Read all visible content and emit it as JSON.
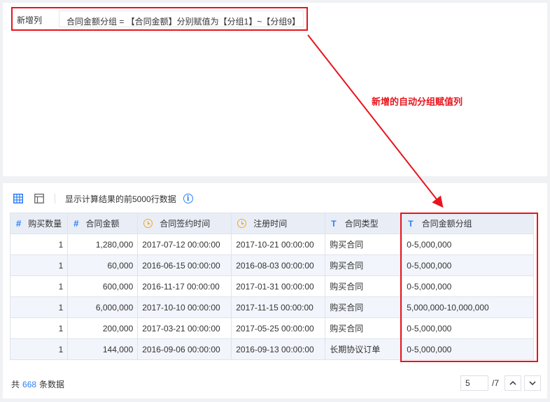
{
  "formula": {
    "label": "新增列",
    "expression": "合同金额分组 = 【合同金额】分别赋值为【分组1】~【分组9】"
  },
  "annotation": {
    "text": "新增的自动分组赋值列",
    "color": "#e8141d"
  },
  "toolbar": {
    "info_text": "显示计算结果的前5000行数据",
    "icons": [
      "grid-view-icon",
      "table-view-icon",
      "info-icon"
    ]
  },
  "table": {
    "headers": [
      {
        "label": "购买数量",
        "icon": "hash"
      },
      {
        "label": "合同金额",
        "icon": "hash"
      },
      {
        "label": "合同签约时间",
        "icon": "clock"
      },
      {
        "label": "注册时间",
        "icon": "clock"
      },
      {
        "label": "合同类型",
        "icon": "text"
      },
      {
        "label": "合同金额分组",
        "icon": "text"
      }
    ],
    "rows": [
      [
        "1",
        "1,280,000",
        "2017-07-12 00:00:00",
        "2017-10-21 00:00:00",
        "购买合同",
        "0-5,000,000"
      ],
      [
        "1",
        "60,000",
        "2016-06-15 00:00:00",
        "2016-08-03 00:00:00",
        "购买合同",
        "0-5,000,000"
      ],
      [
        "1",
        "600,000",
        "2016-11-17 00:00:00",
        "2017-01-31 00:00:00",
        "购买合同",
        "0-5,000,000"
      ],
      [
        "1",
        "6,000,000",
        "2017-10-10 00:00:00",
        "2017-11-15 00:00:00",
        "购买合同",
        "5,000,000-10,000,000"
      ],
      [
        "1",
        "200,000",
        "2017-03-21 00:00:00",
        "2017-05-25 00:00:00",
        "购买合同",
        "0-5,000,000"
      ],
      [
        "1",
        "144,000",
        "2016-09-06 00:00:00",
        "2016-09-13 00:00:00",
        "长期协议订单",
        "0-5,000,000"
      ]
    ]
  },
  "footer": {
    "prefix": "共",
    "count": "668",
    "suffix": "条数据",
    "current_page": "5",
    "total_pages": "/7"
  },
  "colors": {
    "accent": "#2f7ef7",
    "highlight": "#e8141d",
    "time_icon": "#f5a623"
  }
}
